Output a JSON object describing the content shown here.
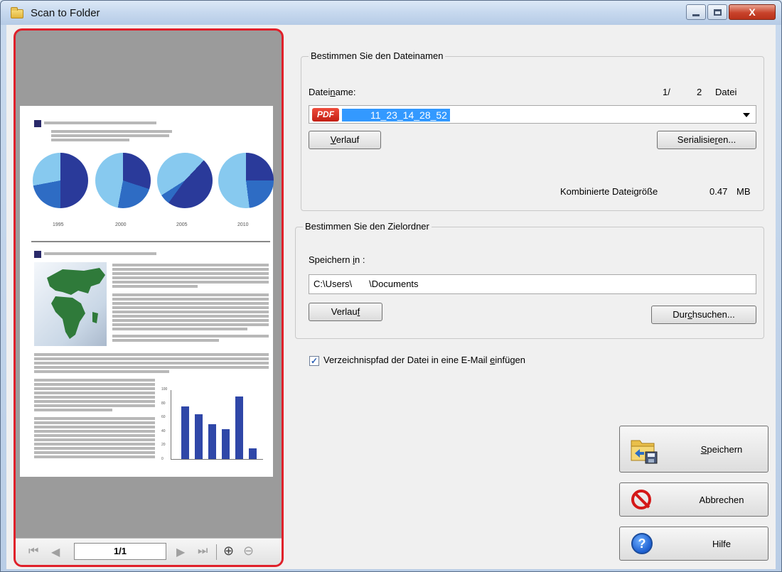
{
  "window": {
    "title": "Scan to Folder",
    "icon": "folder-icon",
    "controls": {
      "minimize": "minimize-icon",
      "maximize": "maximize-icon",
      "close": "X"
    }
  },
  "preview": {
    "years": [
      "1995",
      "2000",
      "2005",
      "2010"
    ],
    "nav": {
      "first": "⏮",
      "prev": "◀",
      "page_indicator": "1/1",
      "next": "▶",
      "last": "⏭",
      "zoom_in": "⊕",
      "zoom_out": "⊖"
    },
    "bar_chart_values": [
      75,
      64,
      50,
      43,
      90,
      15
    ],
    "bar_chart_axis": [
      "100",
      "80",
      "60",
      "40",
      "20",
      "0"
    ]
  },
  "filename_group": {
    "legend": "Bestimmen Sie den Dateinamen",
    "label_pre": "Datei",
    "label_u": "n",
    "label_post": "ame:",
    "file_index": "1/",
    "file_total": "2",
    "file_unit": "Datei",
    "file_type_badge": "PDF",
    "filename_value": "11_23_14_28_52",
    "history_button": {
      "pre": "",
      "u": "V",
      "post": "erlauf"
    },
    "serialize_button": {
      "pre": "Serialisie",
      "u": "r",
      "post": "en..."
    },
    "combined_size_label": "Kombinierte Dateigröße",
    "combined_size_value": "0.47",
    "combined_size_unit": "MB"
  },
  "folder_group": {
    "legend": "Bestimmen Sie den Zielordner",
    "label_pre": "Speichern ",
    "label_u": "i",
    "label_post": "n :",
    "path_pre": "C:\\Users\\",
    "path_post": "\\Documents",
    "history_button": {
      "pre": "Verlau",
      "u": "f",
      "post": ""
    },
    "browse_button": {
      "pre": "Dur",
      "u": "c",
      "post": "hsuchen..."
    }
  },
  "email_option": {
    "checked": "✓",
    "label_pre": "Verzeichnispfad der Datei in eine E-Mail ",
    "label_u": "e",
    "label_post": "infügen"
  },
  "actions": {
    "save": {
      "pre": "",
      "u": "S",
      "post": "peichern",
      "icon": "save-folder-icon"
    },
    "cancel": {
      "label": "Abbrechen",
      "icon": "cancel-icon"
    },
    "help": {
      "label": "Hilfe",
      "icon": "help-icon",
      "glyph": "?"
    }
  }
}
